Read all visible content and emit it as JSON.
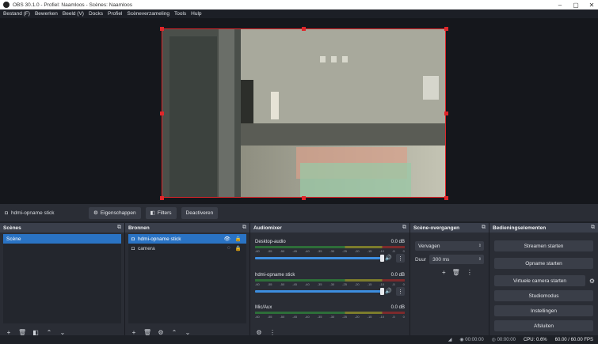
{
  "window": {
    "title": "OBS 30.1.0 - Profiel: Naamloos - Scènes: Naamloos",
    "controls": [
      "–",
      "▢",
      "✕"
    ]
  },
  "menu": [
    "Bestand (F)",
    "Bewerken",
    "Beeld (V)",
    "Docks",
    "Profiel",
    "Scèneverzameling",
    "Tools",
    "Hulp"
  ],
  "source_toolbar": {
    "selected_source": "hdmi-opname stick",
    "properties": "Eigenschappen",
    "filters": "Filters",
    "deactivate": "Deactiveren"
  },
  "scenes": {
    "title": "Scènes",
    "items": [
      "Scène"
    ]
  },
  "sources": {
    "title": "Bronnen",
    "items": [
      {
        "name": "hdmi-opname stick",
        "selected": true
      },
      {
        "name": "camera",
        "selected": false
      }
    ]
  },
  "mixer": {
    "title": "Audiomixer",
    "scale": [
      "-60",
      "-55",
      "-50",
      "-45",
      "-40",
      "-35",
      "-30",
      "-25",
      "-20",
      "-15",
      "-10",
      "-5",
      "0"
    ],
    "channels": [
      {
        "name": "Desktop-audio",
        "db": "0.0 dB"
      },
      {
        "name": "hdmi-opname stick",
        "db": "0.0 dB"
      },
      {
        "name": "Mic/Aux",
        "db": "0.0 dB"
      }
    ]
  },
  "transitions": {
    "title": "Scène-overgangen",
    "selected": "Vervagen",
    "duration_label": "Duur",
    "duration": "300 ms"
  },
  "controls": {
    "title": "Bedieningselementen",
    "buttons": [
      "Streamen starten",
      "Opname starten",
      "Virtuele camera starten",
      "Studiomodus",
      "Instellingen",
      "Afsluiten"
    ]
  },
  "status": {
    "stream_time": "00:00:00",
    "rec_time": "00:00:00",
    "cpu": "CPU: 0.6%",
    "fps": "60.00 / 60.00 FPS"
  },
  "colors": {
    "selection": "#e0262a",
    "accent": "#2a73c4",
    "panel": "#2a2d35",
    "background": "#1e2127"
  }
}
